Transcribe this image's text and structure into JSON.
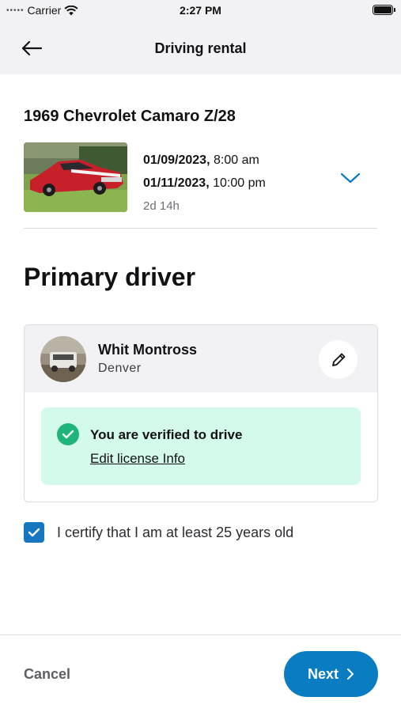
{
  "status_bar": {
    "carrier": "Carrier",
    "time": "2:27 PM"
  },
  "header": {
    "title": "Driving rental"
  },
  "vehicle": {
    "name": "1969 Chevrolet Camaro Z/28",
    "start_date": "01/09/2023,",
    "start_time": " 8:00 am",
    "end_date": "01/11/2023,",
    "end_time": " 10:00 pm",
    "duration": "2d 14h"
  },
  "section": {
    "heading": "Primary driver"
  },
  "driver": {
    "name": "Whit Montross",
    "city": "Denver",
    "verified_text": "You are verified to drive",
    "license_link": "Edit license Info"
  },
  "certify": {
    "label": "I certify that I am at least 25 years old",
    "checked": true
  },
  "footer": {
    "cancel_label": "Cancel",
    "next_label": "Next"
  },
  "colors": {
    "accent": "#0a7cc1",
    "checkbox": "#1776c0",
    "verified_bg": "#d3faeb",
    "verified_check": "#1fb57a"
  }
}
